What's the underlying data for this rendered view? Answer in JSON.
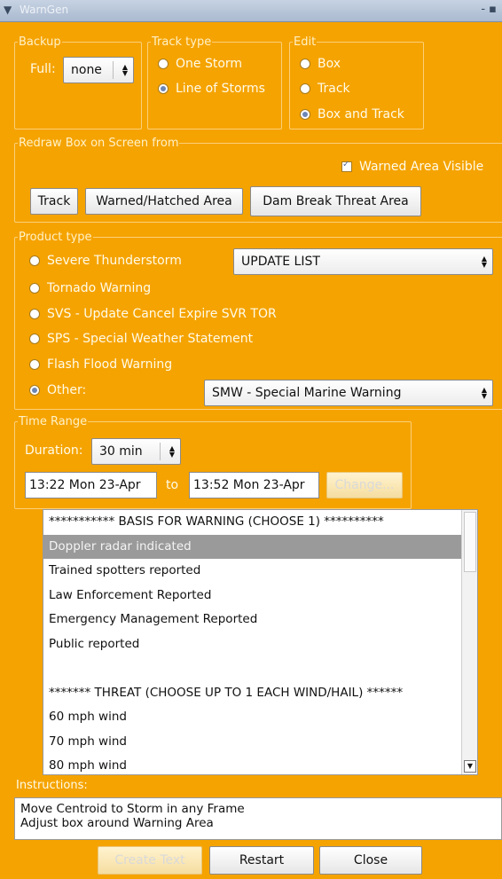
{
  "window": {
    "title": "WarnGen",
    "controls": "- ▪"
  },
  "backup": {
    "legend": "Backup",
    "full_label": "Full:",
    "full_value": "none"
  },
  "track_type": {
    "legend": "Track type",
    "options": [
      "One Storm",
      "Line of Storms"
    ],
    "selected": "Line of Storms"
  },
  "edit": {
    "legend": "Edit",
    "options": [
      "Box",
      "Track",
      "Box and Track"
    ],
    "selected": "Box and Track"
  },
  "redraw": {
    "legend": "Redraw Box on Screen from",
    "warned_area_visible_label": "Warned Area Visible",
    "warned_area_visible": true,
    "buttons": [
      "Track",
      "Warned/Hatched Area",
      "Dam Break Threat Area"
    ]
  },
  "product_type": {
    "legend": "Product type",
    "options": [
      "Severe Thunderstorm",
      "Tornado Warning",
      "SVS - Update Cancel Expire SVR TOR",
      "SPS - Special Weather Statement",
      "Flash Flood Warning",
      "Other:"
    ],
    "selected": "Other:",
    "update_list_value": "UPDATE LIST",
    "other_value": "SMW - Special Marine Warning"
  },
  "time_range": {
    "legend": "Time Range",
    "duration_label": "Duration:",
    "duration_value": "30 min",
    "start": "13:22 Mon 23-Apr",
    "to_label": "to",
    "end": "13:52 Mon 23-Apr",
    "change_label": "Change..."
  },
  "bullets": {
    "items": [
      "*********** BASIS FOR WARNING (CHOOSE 1) **********",
      "Doppler radar indicated",
      "Trained spotters reported",
      "Law Enforcement Reported",
      "Emergency Management Reported",
      "Public reported",
      "",
      "******* THREAT (CHOOSE UP TO 1 EACH WIND/HAIL) ******",
      "60 mph wind",
      "70 mph wind",
      "80 mph wind"
    ],
    "selected_index": 1
  },
  "instructions": {
    "label": "Instructions:",
    "lines": [
      "Move Centroid to Storm in any Frame",
      "Adjust box around Warning Area"
    ]
  },
  "footer": {
    "create_text": "Create Text",
    "restart": "Restart",
    "close": "Close"
  },
  "colors": {
    "background": "#f5a300",
    "selection": "#9a9a9a",
    "radio_on": "#6c86b5"
  }
}
